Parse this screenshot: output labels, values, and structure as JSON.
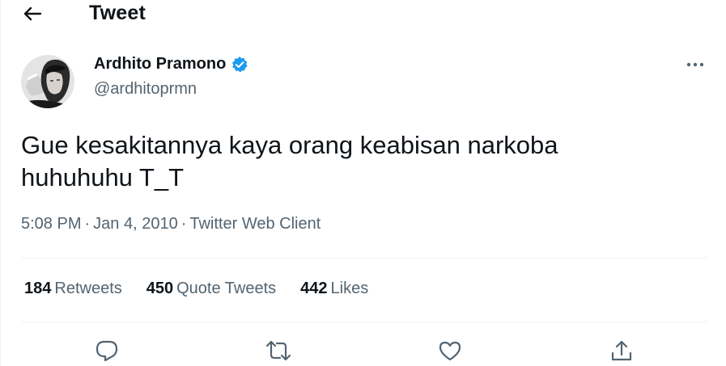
{
  "header": {
    "title": "Tweet"
  },
  "author": {
    "name": "Ardhito Pramono",
    "handle": "@ardhitoprmn"
  },
  "tweet": {
    "text_line1": "Gue kesakitannya kaya orang keabisan narkoba",
    "text_line2": "huhuhuhu T_T",
    "time": "5:08 PM",
    "date": "Jan 4, 2010",
    "source": "Twitter Web Client"
  },
  "stats": {
    "retweets_count": "184",
    "retweets_label": "Retweets",
    "quotes_count": "450",
    "quotes_label": "Quote Tweets",
    "likes_count": "442",
    "likes_label": "Likes"
  },
  "colors": {
    "verified": "#1d9bf0",
    "secondary_text": "#536471",
    "primary_text": "#0f1419",
    "divider": "#eff3f4"
  },
  "icons": [
    "back-arrow-icon",
    "verified-badge-icon",
    "more-icon",
    "reply-icon",
    "retweet-icon",
    "like-icon",
    "share-icon"
  ]
}
